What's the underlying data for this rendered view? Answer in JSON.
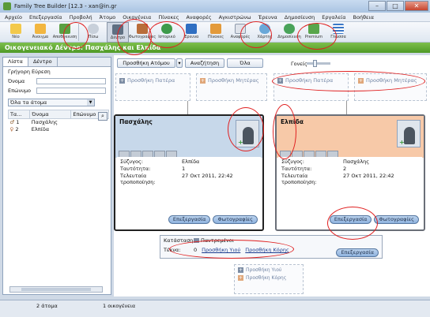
{
  "window": {
    "title": "Family Tree Builder [12.3 - xan@in.gr",
    "buttons": [
      "–",
      "□",
      "✕"
    ]
  },
  "menu": [
    "Αρχείο",
    "Επεξεργασία",
    "Προβολή",
    "Άτομο",
    "Οικογένεια",
    "Πίνακες",
    "Αναφορές",
    "Αγκιστρώνω",
    "Έρευνα",
    "Δημοσίευση",
    "Εργαλεία",
    "Βοήθεια"
  ],
  "toolbar": [
    {
      "label": "Νέο",
      "icon": "new-file-icon",
      "color": "#f3c94b"
    },
    {
      "label": "Άνοιγμα",
      "icon": "open-folder-icon",
      "color": "#f2b640"
    },
    {
      "label": "Αποθήκευση",
      "icon": "save-icon",
      "color": "#5aa142"
    },
    {
      "label": "Πίσω",
      "icon": "back-arrow-icon",
      "color": "#c8d0da"
    },
    {
      "label": "Δέντρο",
      "icon": "tree-view-icon",
      "color": "#5f6f82"
    },
    {
      "label": "Φωτογραφίες",
      "icon": "photos-icon",
      "color": "#b96d3a"
    },
    {
      "label": "Ιστορικό",
      "icon": "history-icon",
      "color": "#3d9a4a"
    },
    {
      "label": "Έρευνα",
      "icon": "research-icon",
      "color": "#2f6fc2"
    },
    {
      "label": "Πίνακες",
      "icon": "tables-icon",
      "color": "#e39a3a"
    },
    {
      "label": "Αναφορές",
      "icon": "reports-icon",
      "color": "#dfe3ea"
    },
    {
      "label": "Χάρτης",
      "icon": "map-icon",
      "color": "#6aa8d8"
    },
    {
      "label": "Δημοσίευση",
      "icon": "publish-icon",
      "color": "#49a35a"
    },
    {
      "label": "Premium",
      "icon": "premium-icon",
      "color": "#58a64b"
    },
    {
      "label": "Γλώσσα",
      "icon": "language-flag-icon",
      "color": "#3a77c7"
    }
  ],
  "banner": "Οικογενειακό Δέντρο: Πασχάλης και Ελπίδα",
  "left": {
    "tabs": [
      "Λίστα",
      "Δέντρο"
    ],
    "quick_search": "Γρήγορη Εύρεση",
    "first_name": "Όνομα",
    "last_name": "Επώνυμο",
    "filter": "Όλα τα άτομα",
    "columns": [
      "Τα...",
      "Όνομα",
      "Επώνυμο"
    ],
    "rows": [
      {
        "num": "1",
        "name": "Πασχάλης",
        "surname": ""
      },
      {
        "num": "2",
        "name": "Ελπίδα",
        "surname": ""
      }
    ]
  },
  "actions": {
    "add_person": "Προσθήκη Ατόμου",
    "search": "Αναζήτηση",
    "all": "Όλα",
    "zoom": "Γονείς"
  },
  "add_father": "Προσθήκη Πατέρα",
  "add_mother": "Προσθήκη Μητέρας",
  "husband": {
    "name": "Πασχάλης",
    "spouse_label": "Σύζυγος:",
    "spouse": "Ελπίδα",
    "id_label": "Ταυτότητα:",
    "id": "1",
    "modified_label": "Τελευταία τροποποίηση:",
    "modified": "27 Οκτ 2011, 22:42",
    "edit": "Επεξεργασία",
    "photos": "Φωτογραφίες",
    "color": "#c7d8ea"
  },
  "wife": {
    "name": "Ελπίδα",
    "spouse_label": "Σύζυγος:",
    "spouse": "Πασχάλης",
    "id_label": "Ταυτότητα:",
    "id": "2",
    "modified_label": "Τελευταία τροποποίηση:",
    "modified": "27 Οκτ 2011, 22:42",
    "edit": "Επεξεργασία",
    "photos": "Φωτογραφίες",
    "color": "#f7c9a8"
  },
  "family": {
    "status_label": "Κατάσταση:",
    "status_value": "Παντρεμένοι",
    "children_label": "Τέκνα:",
    "children_count": "0",
    "add_son": "Προσθήκη Υιού",
    "add_daughter": "Προσθήκη Κόρης",
    "edit": "Επεξεργασία"
  },
  "child_box": {
    "add_son": "Προσθήκη Υιού",
    "add_daughter": "Προσθήκη Κόρης"
  },
  "statusbar": {
    "people": "2 άτομα",
    "families": "1 οικογένεια"
  }
}
